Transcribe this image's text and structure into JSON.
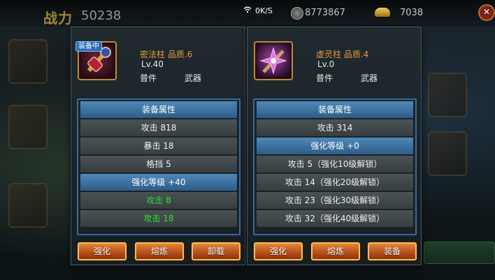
{
  "topbar": {
    "power_label": "战力",
    "power_value": "50238",
    "net_speed": "0K/S",
    "coins": "8773867",
    "ingots": "7038"
  },
  "icons": {
    "wifi": "wifi-icon",
    "coin": "coin-icon",
    "ingot": "gold-ingot-icon",
    "close": "close-icon"
  },
  "left_panel": {
    "equipped_tag": "装备中",
    "name": "密法柱",
    "quality": "品质.6",
    "level": "Lv.40",
    "type": "普件",
    "slot": "武器",
    "attrs": [
      {
        "text": "装备属性",
        "style": "head"
      },
      {
        "text": "攻击  818",
        "style": "normal"
      },
      {
        "text": "暴击  18",
        "style": "normal"
      },
      {
        "text": "格挡  5",
        "style": "normal"
      },
      {
        "text": "强化等级  +40",
        "style": "head"
      },
      {
        "text": "攻击  8",
        "style": "green"
      },
      {
        "text": "攻击  18",
        "style": "green"
      }
    ],
    "buttons": [
      "强化",
      "熔炼",
      "卸载"
    ]
  },
  "right_panel": {
    "name": "虚灵柱",
    "quality": "品质.4",
    "level": "Lv.0",
    "type": "普件",
    "slot": "武器",
    "attrs": [
      {
        "text": "装备属性",
        "style": "head"
      },
      {
        "text": "攻击  314",
        "style": "normal"
      },
      {
        "text": "强化等级  +0",
        "style": "head"
      },
      {
        "text": "攻击 5（强化10级解锁）",
        "style": "normal"
      },
      {
        "text": "攻击 14（强化20级解锁）",
        "style": "normal"
      },
      {
        "text": "攻击 23（强化30级解锁）",
        "style": "normal"
      },
      {
        "text": "攻击 32（强化40级解锁）",
        "style": "normal"
      }
    ],
    "buttons": [
      "强化",
      "熔炼",
      "装备"
    ]
  },
  "colors": {
    "quality_name": "#e09a40",
    "green_attr": "#30e030",
    "header_blue": "#4f88b8",
    "button_orange": "#e08838"
  }
}
